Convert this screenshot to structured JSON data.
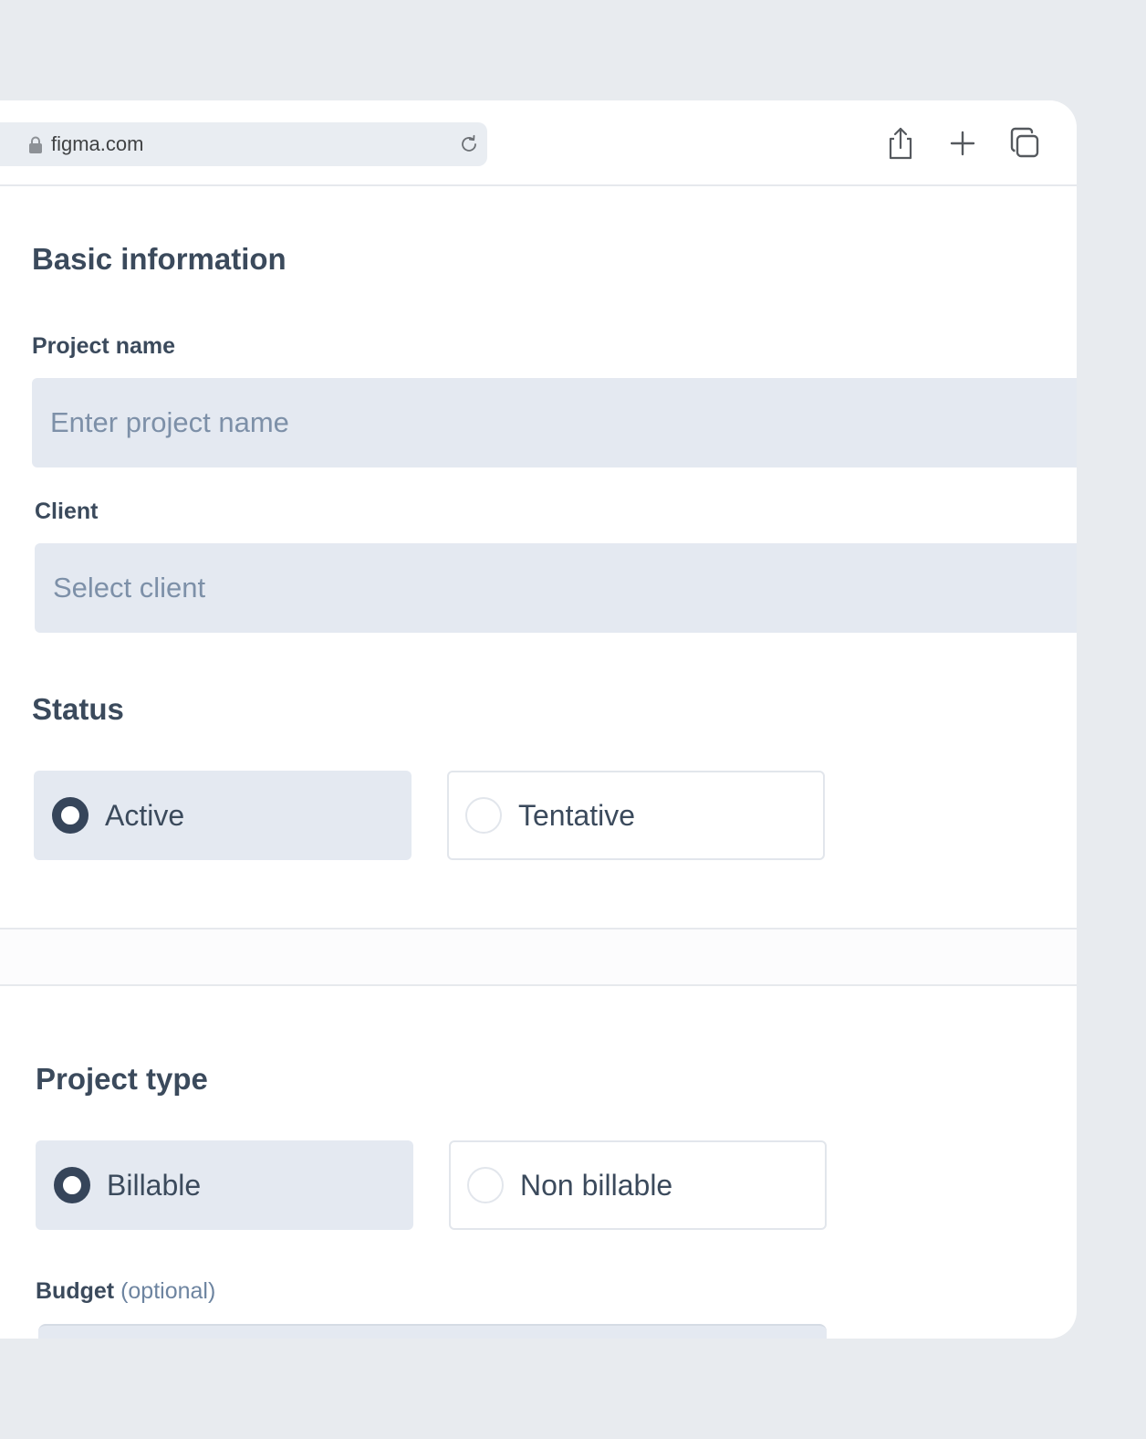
{
  "browser": {
    "url": "figma.com",
    "icons": {
      "lock": "lock-icon",
      "reload": "reload-icon",
      "share": "share-icon",
      "new_tab": "plus-icon",
      "tabs": "tabs-overview-icon"
    }
  },
  "form": {
    "basic_info": {
      "heading": "Basic information",
      "project_name_label": "Project name",
      "project_name_placeholder": "Enter project name",
      "project_name_value": "",
      "client_label": "Client",
      "client_placeholder": "Select client"
    },
    "status": {
      "heading": "Status",
      "options": [
        {
          "label": "Active",
          "selected": true
        },
        {
          "label": "Tentative",
          "selected": false
        }
      ]
    },
    "project_type": {
      "heading": "Project type",
      "options": [
        {
          "label": "Billable",
          "selected": true
        },
        {
          "label": "Non billable",
          "selected": false
        }
      ]
    },
    "budget": {
      "label": "Budget",
      "optional_tag": "(optional)"
    }
  },
  "colors": {
    "page_bg": "#e8ebef",
    "input_bg": "#e4e9f1",
    "text_primary": "#3b4a5c",
    "placeholder": "#7d90a8",
    "radio_selected": "#36455a"
  }
}
